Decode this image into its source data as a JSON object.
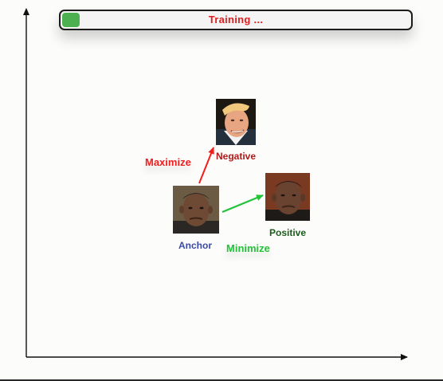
{
  "progress": {
    "label": "Training ...",
    "fraction": 0.05,
    "fill_color": "#4caf50",
    "text_color": "#e02020"
  },
  "nodes": {
    "negative": {
      "label": "Negative",
      "color": "#b01a1a"
    },
    "positive": {
      "label": "Positive",
      "color": "#1a5c1a"
    },
    "anchor": {
      "label": "Anchor",
      "color": "#3a4aa8"
    }
  },
  "edges": {
    "maximize": {
      "label": "Maximize",
      "color": "#f02020"
    },
    "minimize": {
      "label": "Minimize",
      "color": "#22c33a"
    }
  },
  "axes": {
    "color": "#111111"
  }
}
